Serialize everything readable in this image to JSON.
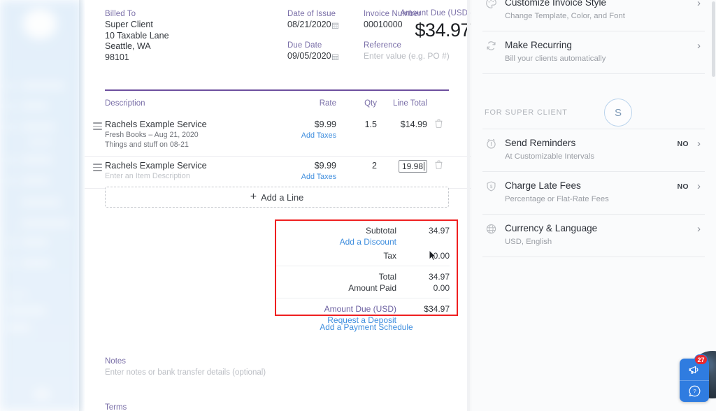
{
  "invoice": {
    "billed_to": {
      "label": "Billed To",
      "lines": [
        "Super Client",
        "10 Taxable Lane",
        "Seattle, WA",
        "98101"
      ]
    },
    "date_of_issue": {
      "label": "Date of Issue",
      "value": "08/21/2020"
    },
    "due_date": {
      "label": "Due Date",
      "value": "09/05/2020"
    },
    "invoice_number": {
      "label": "Invoice Number",
      "value": "00010000"
    },
    "reference": {
      "label": "Reference",
      "placeholder": "Enter value (e.g. PO #)"
    },
    "amount_due": {
      "label": "Amount Due (USD)",
      "value": "$34.97"
    },
    "table": {
      "headers": {
        "description": "Description",
        "rate": "Rate",
        "qty": "Qty",
        "line_total": "Line Total"
      },
      "rows": [
        {
          "title": "Rachels Example Service",
          "sub1": "Fresh Books – Aug 21, 2020",
          "sub2": "Things and stuff on 08-21",
          "rate": "$9.99",
          "add_taxes": "Add Taxes",
          "qty": "1.5",
          "line_total": "$14.99",
          "editing": false
        },
        {
          "title": "Rachels Example Service",
          "sub_placeholder": "Enter an Item Description",
          "rate": "$9.99",
          "add_taxes": "Add Taxes",
          "qty": "2",
          "line_total": "19.98",
          "editing": true
        }
      ]
    },
    "add_line_label": "Add a Line",
    "totals": {
      "subtotal_label": "Subtotal",
      "subtotal_value": "34.97",
      "add_discount_label": "Add a Discount",
      "tax_label": "Tax",
      "tax_value": "0.00",
      "total_label": "Total",
      "total_value": "34.97",
      "amount_paid_label": "Amount Paid",
      "amount_paid_value": "0.00",
      "amount_due_label": "Amount Due (USD)",
      "amount_due_value": "$34.97",
      "request_deposit_label": "Request a Deposit"
    },
    "payment_schedule_label": "Add a Payment Schedule",
    "notes": {
      "label": "Notes",
      "placeholder": "Enter notes or bank transfer details (optional)"
    },
    "terms": {
      "label": "Terms"
    }
  },
  "right_panel": {
    "items": [
      {
        "title": "Customize Invoice Style",
        "subtitle": "Change Template, Color, and Font",
        "icon": "palette-icon",
        "status": ""
      },
      {
        "title": "Make Recurring",
        "subtitle": "Bill your clients automatically",
        "icon": "refresh-icon",
        "status": ""
      },
      {
        "title": "Send Reminders",
        "subtitle": "At Customizable Intervals",
        "icon": "alarm-clock-icon",
        "status": "NO"
      },
      {
        "title": "Charge Late Fees",
        "subtitle": "Percentage or Flat-Rate Fees",
        "icon": "dollar-badge-icon",
        "status": "NO"
      },
      {
        "title": "Currency & Language",
        "subtitle": "USD, English",
        "icon": "globe-icon",
        "status": ""
      }
    ],
    "client_section_label": "FOR SUPER CLIENT",
    "client_avatar_initial": "S"
  },
  "support_widget": {
    "notification_count": "27",
    "announce_icon": "megaphone-icon",
    "help_icon": "question-circle-icon"
  },
  "colors": {
    "accent_purple": "#6d4f9e",
    "label_purple": "#7a6fa8",
    "link_blue": "#3f8ede",
    "highlight_red": "#ef1f20",
    "support_blue": "#2f7ce0",
    "badge_red": "#e8292f"
  }
}
